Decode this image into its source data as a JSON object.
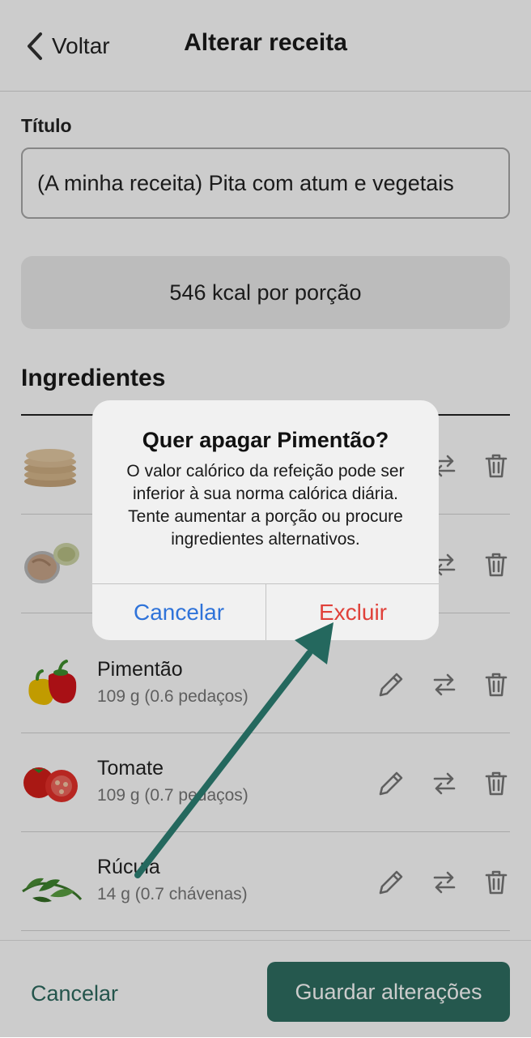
{
  "header": {
    "back_label": "Voltar",
    "title": "Alterar receita"
  },
  "form": {
    "title_label": "Título",
    "title_value": "(A minha receita) Pita com atum e vegetais",
    "kcal_text": "546 kcal por porção"
  },
  "ingredients": {
    "heading": "Ingredientes",
    "items": [
      {
        "name": "Pimentão",
        "qty": "109 g (0.6 pedaços)"
      },
      {
        "name": "Tomate",
        "qty": "109 g (0.7 pedaços)"
      },
      {
        "name": "Rúcula",
        "qty": "14 g (0.7 chávenas)"
      }
    ]
  },
  "footer": {
    "cancel_label": "Cancelar",
    "save_label": "Guardar alterações"
  },
  "dialog": {
    "title": "Quer apagar Pimentão?",
    "message": "O valor calórico da refeição pode ser inferior à sua norma calórica diária. Tente aumentar a porção ou procure ingredientes alternativos.",
    "cancel_label": "Cancelar",
    "delete_label": "Excluir"
  },
  "colors": {
    "accent": "#2f6e62",
    "dialog_cancel": "#2f73d9",
    "dialog_delete": "#e0413a",
    "annotation_arrow": "#24685e"
  }
}
